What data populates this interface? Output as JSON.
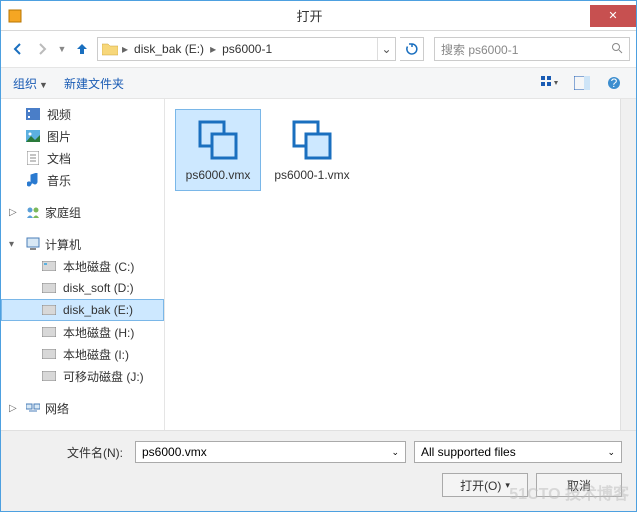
{
  "titlebar": {
    "title": "打开"
  },
  "nav": {
    "breadcrumb": [
      "disk_bak (E:)",
      "ps6000-1"
    ],
    "search_placeholder": "搜索 ps6000-1"
  },
  "toolbar": {
    "organize": "组织",
    "new_folder": "新建文件夹"
  },
  "sidebar": {
    "libs": [
      {
        "icon": "video",
        "label": "视频"
      },
      {
        "icon": "picture",
        "label": "图片"
      },
      {
        "icon": "document",
        "label": "文档"
      },
      {
        "icon": "music",
        "label": "音乐"
      }
    ],
    "homegroup": {
      "label": "家庭组"
    },
    "computer": {
      "label": "计算机"
    },
    "drives": [
      {
        "label": "本地磁盘 (C:)"
      },
      {
        "label": "disk_soft (D:)"
      },
      {
        "label": "disk_bak (E:)",
        "selected": true
      },
      {
        "label": "本地磁盘 (H:)"
      },
      {
        "label": "本地磁盘 (I:)"
      },
      {
        "label": "可移动磁盘 (J:)"
      }
    ],
    "network": {
      "label": "网络"
    }
  },
  "files": [
    {
      "name": "ps6000.vmx",
      "selected": true
    },
    {
      "name": "ps6000-1.vmx",
      "selected": false
    }
  ],
  "footer": {
    "filename_label": "文件名(N):",
    "filename_value": "ps6000.vmx",
    "filter": "All supported files",
    "open_btn": "打开(O)",
    "cancel_btn": "取消"
  },
  "watermark": "51CTO 技术博客"
}
